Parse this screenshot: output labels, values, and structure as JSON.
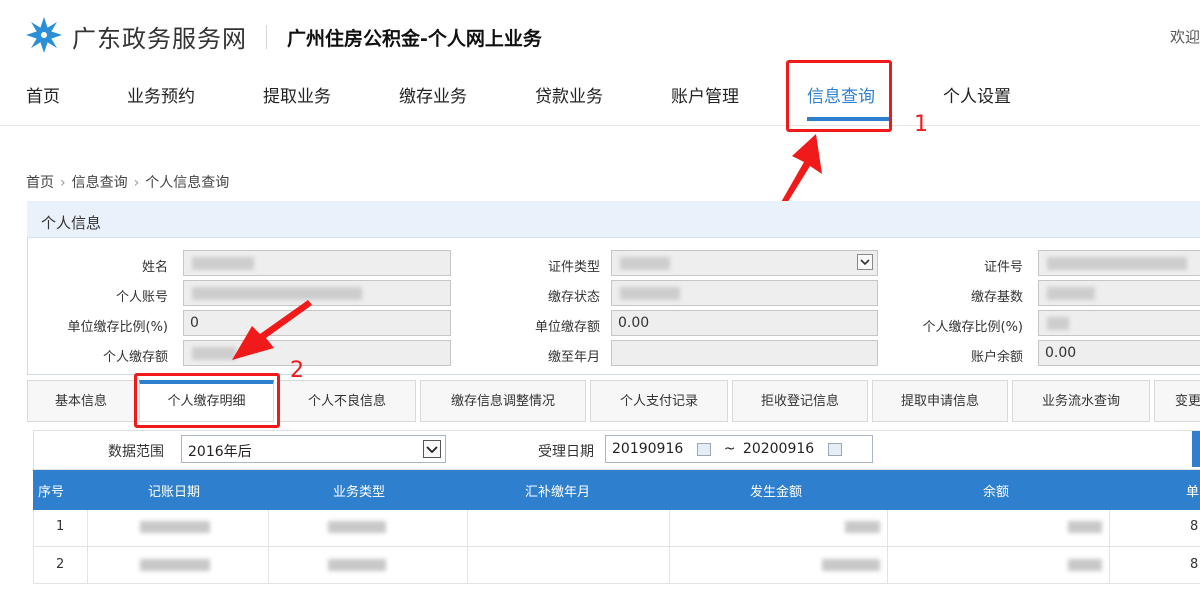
{
  "header": {
    "site_name": "广东政务服务网",
    "page_title": "广州住房公积金-个人网上业务",
    "welcome": "欢迎"
  },
  "nav": {
    "items": [
      "首页",
      "业务预约",
      "提取业务",
      "缴存业务",
      "贷款业务",
      "账户管理",
      "信息查询",
      "个人设置"
    ],
    "active": "信息查询"
  },
  "annotations": {
    "step1": "1",
    "step2": "2"
  },
  "breadcrumb": {
    "items": [
      "首页",
      "信息查询",
      "个人信息查询"
    ],
    "separator": "›"
  },
  "personal_info": {
    "title": "个人信息",
    "fields": {
      "name": {
        "label": "姓名",
        "value": ""
      },
      "id_type": {
        "label": "证件类型",
        "value": ""
      },
      "id_number": {
        "label": "证件号",
        "value": ""
      },
      "personal_account": {
        "label": "个人账号",
        "value": ""
      },
      "deposit_status": {
        "label": "缴存状态",
        "value": ""
      },
      "deposit_base": {
        "label": "缴存基数",
        "value": ""
      },
      "unit_ratio": {
        "label": "单位缴存比例(%)",
        "value": "0"
      },
      "unit_amount": {
        "label": "单位缴存额",
        "value": "0.00"
      },
      "personal_ratio": {
        "label": "个人缴存比例(%)",
        "value": ""
      },
      "personal_amount": {
        "label": "个人缴存额",
        "value": ""
      },
      "paid_until": {
        "label": "缴至年月",
        "value": ""
      },
      "balance": {
        "label": "账户余额",
        "value": "0.00"
      }
    }
  },
  "tabs": {
    "items": [
      "基本信息",
      "个人缴存明细",
      "个人不良信息",
      "缴存信息调整情况",
      "个人支付记录",
      "拒收登记信息",
      "提取申请信息",
      "业务流水查询",
      "变更"
    ],
    "active": "个人缴存明细"
  },
  "filter": {
    "range_label": "数据范围",
    "range_value": "2016年后",
    "date_label": "受理日期",
    "date_from": "20190916",
    "date_sep": "~",
    "date_to": "20200916"
  },
  "table": {
    "columns": [
      "序号",
      "记账日期",
      "业务类型",
      "汇补缴年月",
      "发生金额",
      "余额",
      "单"
    ],
    "rows": [
      {
        "index": "1",
        "last": "8"
      },
      {
        "index": "2",
        "last": "8"
      }
    ]
  },
  "colors": {
    "accent": "#2f7fcf",
    "annotation": "#f01a1a"
  }
}
